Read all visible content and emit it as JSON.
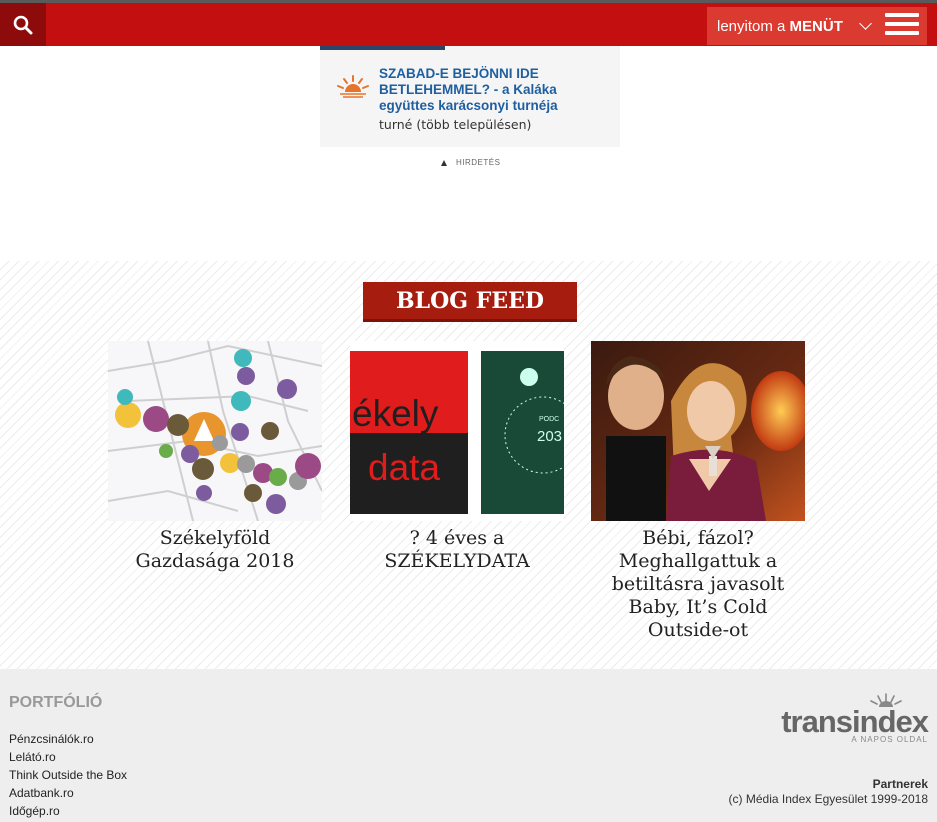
{
  "header": {
    "menu_label_prefix": "lenyitom a ",
    "menu_label_bold": "MENÜT"
  },
  "event": {
    "title": "SZABAD-E BEJÖNNI IDE BETLEHEMMEL? - a Kaláka együttes karácsonyi turnéja",
    "subtitle": "turné (több településen)"
  },
  "ad": {
    "label": "HIRDETÉS"
  },
  "blog": {
    "title": "BLOG FEED",
    "cards": [
      {
        "caption": "Székelyföld Gazdasága 2018"
      },
      {
        "caption": "? 4 éves a SZÉKELYDATA",
        "thumb_text_1": "ékely",
        "thumb_text_2": "data",
        "thumb_text_3": "PODC",
        "thumb_text_4": "203"
      },
      {
        "caption": "Bébi, fázol? Meghallgattuk a betiltásra javasolt Baby, It’s Cold Outside-ot"
      }
    ]
  },
  "footer": {
    "portfolio_title": "PORTFÓLIÓ",
    "links": [
      "Pénzcsinálók.ro",
      "Lelátó.ro",
      "Think Outside the Box",
      "Adatbank.ro",
      "Időgép.ro"
    ],
    "brand_name": "transindex",
    "brand_tagline": "A NAPOS OLDAL",
    "partners": "Partnerek",
    "copyright": "(c) Média Index Egyesület 1999-2018"
  },
  "colors": {
    "brand_red": "#c30f0f",
    "dark_red": "#8e0b0b",
    "blog_title_bg": "#a61d10",
    "link_blue": "#1f5fa0"
  }
}
